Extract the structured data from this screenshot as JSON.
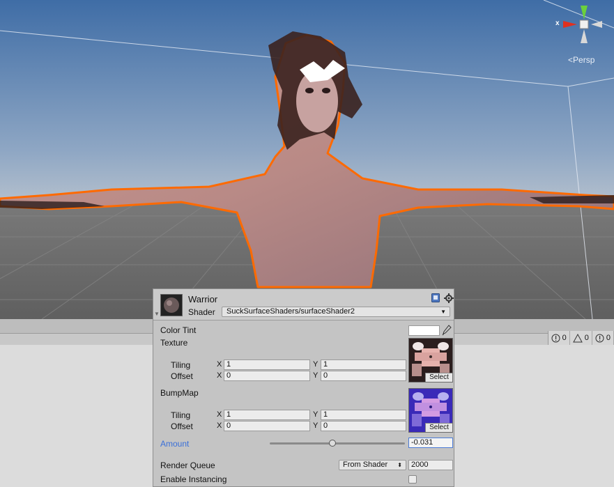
{
  "scene": {
    "view_mode_label": "Persp",
    "gizmo_axis_x": "x"
  },
  "material": {
    "name": "Warrior",
    "shader_label": "Shader",
    "shader_value": "SuckSurfaceShaders/surfaceShader2",
    "properties": {
      "color_tint_label": "Color Tint",
      "color_tint_value": "#ffffff",
      "texture_label": "Texture",
      "texture_tiling_label": "Tiling",
      "texture_offset_label": "Offset",
      "texture_tiling_x": "1",
      "texture_tiling_y": "1",
      "texture_offset_x": "0",
      "texture_offset_y": "0",
      "bumpmap_label": "BumpMap",
      "bumpmap_tiling_label": "Tiling",
      "bumpmap_offset_label": "Offset",
      "bumpmap_tiling_x": "1",
      "bumpmap_tiling_y": "1",
      "bumpmap_offset_x": "0",
      "bumpmap_offset_y": "0",
      "amount_label": "Amount",
      "amount_value": "-0.031",
      "render_queue_label": "Render Queue",
      "render_queue_mode": "From Shader",
      "render_queue_value": "2000",
      "enable_instancing_label": "Enable Instancing",
      "enable_instancing_checked": false
    },
    "select_label": "Select",
    "axis_x": "X",
    "axis_y": "Y"
  },
  "console": {
    "info_count": "0",
    "warning_count": "0",
    "error_count": "0"
  },
  "colors": {
    "sky_top": "#4a76ad",
    "sky_horizon": "#a9b8cb",
    "ground": "#6f6f6f",
    "selection_outline": "#ff6a00",
    "accent_blue": "#3a6fd8"
  }
}
